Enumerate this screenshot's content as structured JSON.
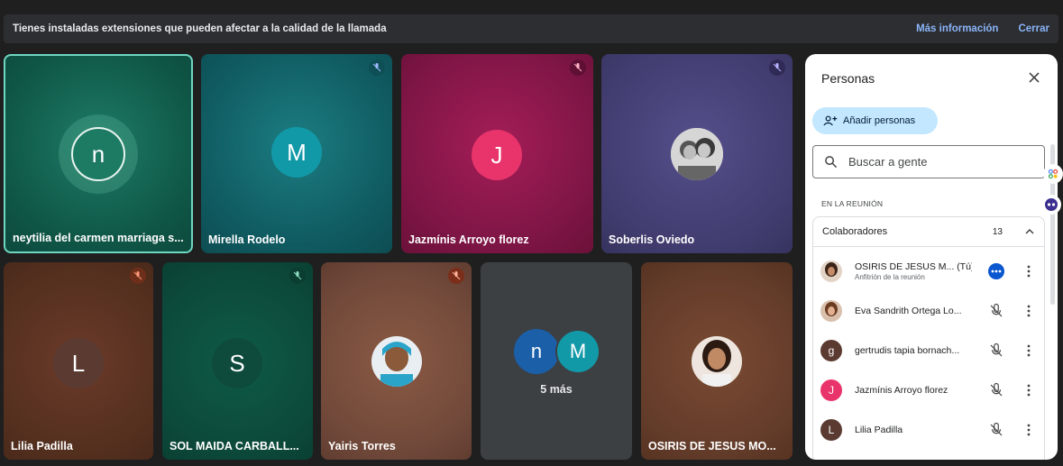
{
  "banner": {
    "message": "Tienes instaladas extensiones que pueden afectar a la calidad de la llamada",
    "more_info": "Más información",
    "close": "Cerrar"
  },
  "tiles": [
    {
      "name": "neytilia del carmen marriaga s...",
      "initial": "n"
    },
    {
      "name": "Mirella Rodelo",
      "initial": "M"
    },
    {
      "name": "Jazmínis Arroyo florez",
      "initial": "J"
    },
    {
      "name": "Soberlis Oviedo"
    },
    {
      "name": "Lilia Padilla",
      "initial": "L"
    },
    {
      "name": "SOL MAIDA CARBALL...",
      "initial": "S"
    },
    {
      "name": "Yairis Torres"
    },
    {
      "more_label": "5 más",
      "initials": [
        "n",
        "M"
      ]
    },
    {
      "name": "OSIRIS DE JESUS MO..."
    }
  ],
  "panel": {
    "title": "Personas",
    "add_label": "Añadir personas",
    "search_placeholder": "Buscar a gente",
    "section_label": "EN LA REUNIÓN",
    "group_label": "Colaboradores",
    "group_count": "13",
    "people": [
      {
        "name": "OSIRIS DE JESUS M... (Tú)",
        "sub": "Anfitrión de la reunión",
        "initial": ""
      },
      {
        "name": "Eva Sandrith Ortega Lo...",
        "initial": ""
      },
      {
        "name": "gertrudis tapia bornach...",
        "initial": "g"
      },
      {
        "name": "Jazmínis Arroyo florez",
        "initial": "J"
      },
      {
        "name": "Lilia Padilla",
        "initial": "L"
      }
    ]
  },
  "colors": {
    "accent": "#8ab4f8",
    "add_button_bg": "#c2e7ff",
    "active_border": "#6fd6c2"
  }
}
